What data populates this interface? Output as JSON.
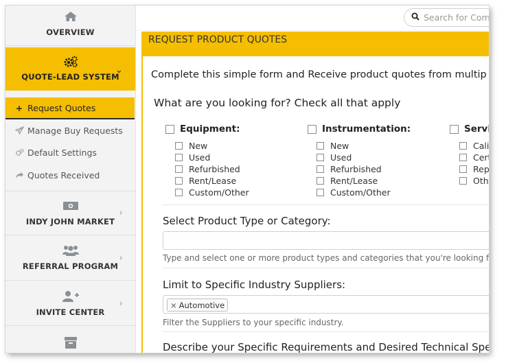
{
  "sidebar": {
    "overview": "OVERVIEW",
    "quote_lead": "QUOTE-LEAD SYSTEM",
    "sub_items": [
      {
        "label": "Request Quotes"
      },
      {
        "label": "Manage Buy Requests"
      },
      {
        "label": "Default Settings"
      },
      {
        "label": "Quotes Received"
      }
    ],
    "indy_market": "INDY JOHN MARKET",
    "referral": "REFERRAL PROGRAM",
    "invite": "INVITE CENTER"
  },
  "topbar": {
    "search_placeholder": "Search for Comp"
  },
  "panel": {
    "title": "REQUEST PRODUCT QUOTES",
    "intro": "Complete this simple form and Receive product quotes from multip",
    "question": "What are you looking for? Check all that apply",
    "columns": [
      {
        "title": "Equipment:",
        "options": [
          "New",
          "Used",
          "Refurbished",
          "Rent/Lease",
          "Custom/Other"
        ]
      },
      {
        "title": "Instrumentation:",
        "options": [
          "New",
          "Used",
          "Refurbished",
          "Rent/Lease",
          "Custom/Other"
        ]
      },
      {
        "title": "Servic",
        "options": [
          "Calib",
          "Cert",
          "Repa",
          "Othe"
        ]
      }
    ],
    "product_label": "Select Product Type or Category:",
    "product_hint": "Type and select one or more product types and categories that you're looking for.",
    "industry_label": "Limit to Specific Industry Suppliers:",
    "industry_tag": "Automotive",
    "industry_hint": "Filter the Suppliers to your specific industry.",
    "describe_label": "Describe your Specific Requirements and Desired Technical Speci"
  },
  "colors": {
    "accent": "#f5be00"
  }
}
